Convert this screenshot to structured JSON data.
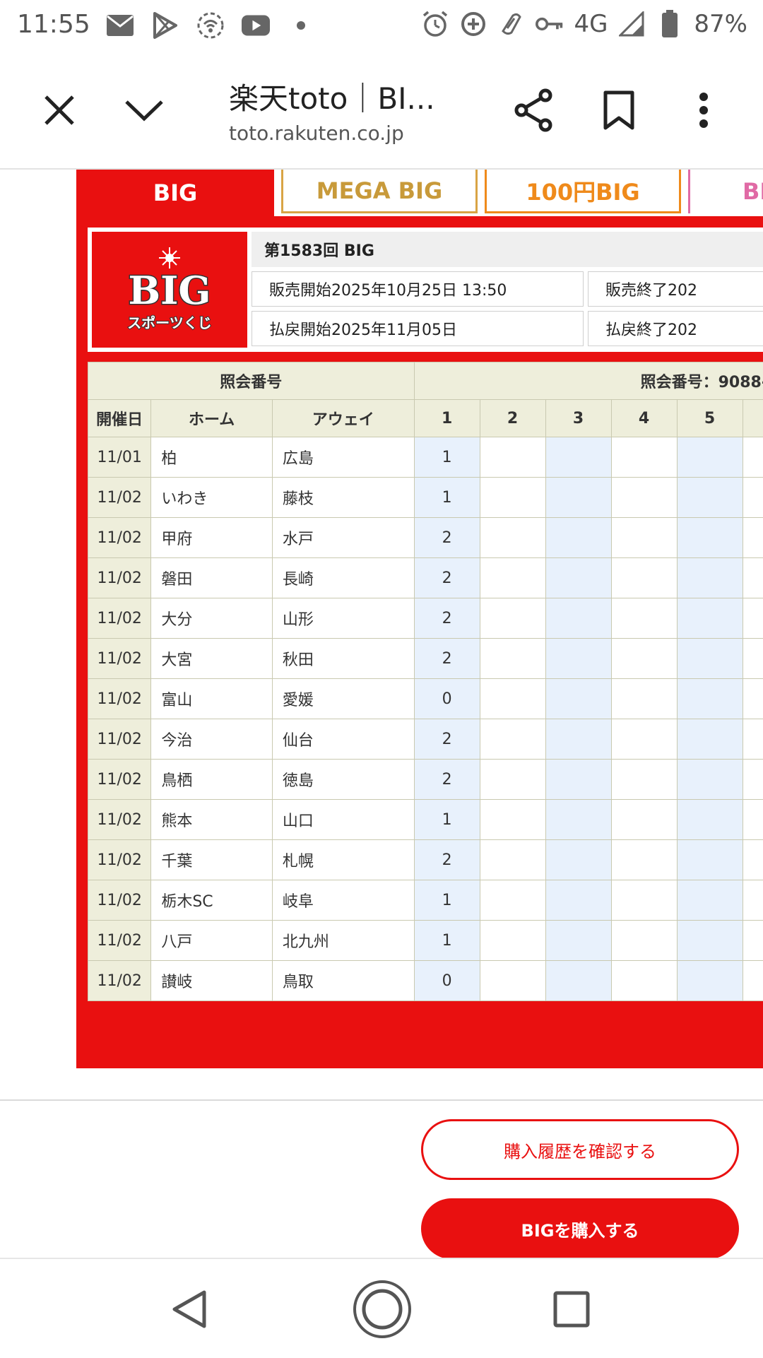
{
  "status_bar": {
    "time": "11:55",
    "left_icons": [
      "mail-au-icon",
      "play-store-icon",
      "wifi-hotspot-icon",
      "youtube-icon",
      "dot-icon"
    ],
    "right_icons": [
      "alarm-icon",
      "data-saver-icon",
      "nfc-icon",
      "key-icon",
      "signal-icon",
      "battery-icon"
    ],
    "network": "4G",
    "battery": "87%"
  },
  "browser": {
    "title": "楽天toto｜BI...",
    "url": "toto.rakuten.co.jp"
  },
  "tabs": [
    {
      "label": "BIG",
      "active": true
    },
    {
      "label": "MEGA BIG"
    },
    {
      "label": "100円BIG"
    },
    {
      "label": "BIG"
    }
  ],
  "round": {
    "title": "第1583回 BIG",
    "sale_start": "販売開始2025年10月25日 13:50",
    "sale_end": "販売終了202",
    "payout_start": "払戻開始2025年11月05日",
    "payout_end": "払戻終了202"
  },
  "logo": {
    "text": "BIG",
    "sub": "スポーツくじ"
  },
  "table": {
    "ref_label": "照会番号",
    "ref_value": "照会番号：9088-",
    "headers": {
      "date": "開催日",
      "home": "ホーム",
      "away": "アウェイ",
      "cols": [
        "1",
        "2",
        "3",
        "4",
        "5"
      ]
    },
    "rows": [
      {
        "date": "11/01",
        "home": "柏",
        "away": "広島",
        "res": "1"
      },
      {
        "date": "11/02",
        "home": "いわき",
        "away": "藤枝",
        "res": "1"
      },
      {
        "date": "11/02",
        "home": "甲府",
        "away": "水戸",
        "res": "2"
      },
      {
        "date": "11/02",
        "home": "磐田",
        "away": "長崎",
        "res": "2"
      },
      {
        "date": "11/02",
        "home": "大分",
        "away": "山形",
        "res": "2"
      },
      {
        "date": "11/02",
        "home": "大宮",
        "away": "秋田",
        "res": "2"
      },
      {
        "date": "11/02",
        "home": "富山",
        "away": "愛媛",
        "res": "0"
      },
      {
        "date": "11/02",
        "home": "今治",
        "away": "仙台",
        "res": "2"
      },
      {
        "date": "11/02",
        "home": "鳥栖",
        "away": "徳島",
        "res": "2"
      },
      {
        "date": "11/02",
        "home": "熊本",
        "away": "山口",
        "res": "1"
      },
      {
        "date": "11/02",
        "home": "千葉",
        "away": "札幌",
        "res": "2"
      },
      {
        "date": "11/02",
        "home": "栃木SC",
        "away": "岐阜",
        "res": "1"
      },
      {
        "date": "11/02",
        "home": "八戸",
        "away": "北九州",
        "res": "1"
      },
      {
        "date": "11/02",
        "home": "讃岐",
        "away": "鳥取",
        "res": "0"
      }
    ]
  },
  "buttons": {
    "history": "購入履歴を確認する",
    "buy": "BIGを購入する"
  },
  "colors": {
    "accent": "#e91010",
    "header_bg": "#eeeedb",
    "col_blue": "#e8f1fc"
  }
}
